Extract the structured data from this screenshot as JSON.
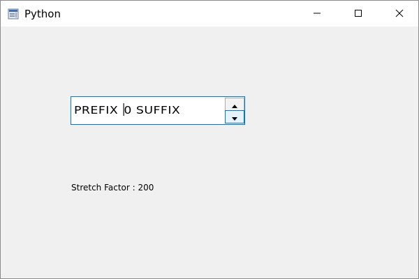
{
  "window": {
    "title": "Python"
  },
  "titlebar": {
    "icon": "app-window-icon",
    "controls": [
      "minimize-icon",
      "maximize-icon",
      "close-icon"
    ]
  },
  "spinbox": {
    "prefix": "PREFIX ",
    "value": "0",
    "suffix": " SUFFIX"
  },
  "label": {
    "text": "Stretch Factor : 200"
  },
  "colors": {
    "focus_border": "#0078d7",
    "background": "#f0f0f0"
  }
}
